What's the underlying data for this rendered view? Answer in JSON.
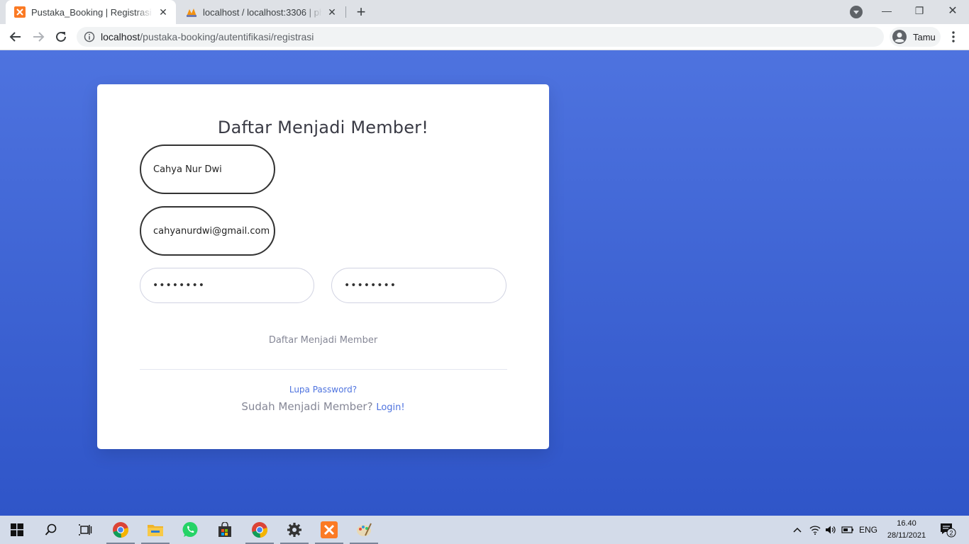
{
  "browser": {
    "tabs": [
      {
        "title": "Pustaka_Booking | Registrasi Member",
        "active": true
      },
      {
        "title": "localhost / localhost:3306 | phpMyAdmin",
        "active": false
      }
    ],
    "url_host": "localhost",
    "url_path": "/pustaka-booking/autentifikasi/registrasi",
    "profile_label": "Tamu"
  },
  "form": {
    "title": "Daftar Menjadi Member!",
    "name_value": "Cahya Nur Dwi",
    "email_value": "cahyanurdwi@gmail.com",
    "password_mask": "••••••••",
    "password_confirm_mask": "••••••••",
    "submit_label": "Daftar Menjadi Member",
    "forgot_label": "Lupa Password?",
    "already_label": "Sudah Menjadi Member?",
    "login_label": "Login!"
  },
  "taskbar": {
    "language": "ENG",
    "time": "16.40",
    "date": "28/11/2021",
    "notification_count": "2",
    "apps": [
      "start",
      "search",
      "task-view",
      "chrome",
      "file-explorer",
      "whatsapp",
      "store",
      "chrome",
      "settings",
      "xampp",
      "paint"
    ]
  },
  "colors": {
    "primary": "#4e73df",
    "background_bottom": "#2f55c8",
    "text_muted": "#858796"
  }
}
